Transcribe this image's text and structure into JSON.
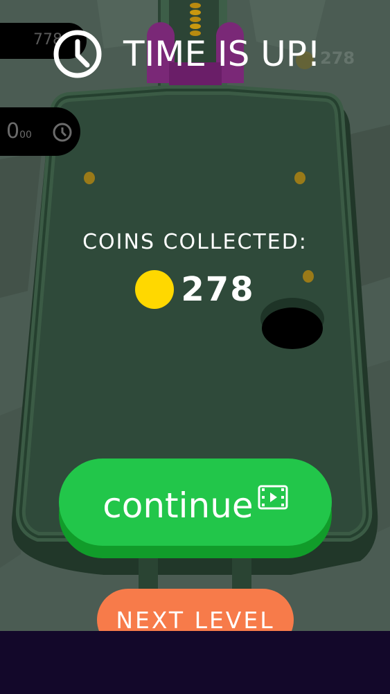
{
  "hud": {
    "top_counter": "778",
    "time_value": "0",
    "time_fraction": "00",
    "ghost_coin_count": "278"
  },
  "header": {
    "title": "TIME IS UP!",
    "icon": "clock-icon"
  },
  "results": {
    "coins_label": "COINS COLLECTED:",
    "coins_value": "278",
    "coin_icon": "coin-icon"
  },
  "actions": {
    "continue_label": "continue",
    "continue_icon": "film-icon",
    "next_level_label": "NEXT LEVEL"
  },
  "colors": {
    "background": "#4a5a52",
    "board": "#2f4a3a",
    "continue": "#22c64a",
    "next_level": "#f77b4a",
    "coin": "#ffd800",
    "bottom_bar": "#13082a"
  }
}
